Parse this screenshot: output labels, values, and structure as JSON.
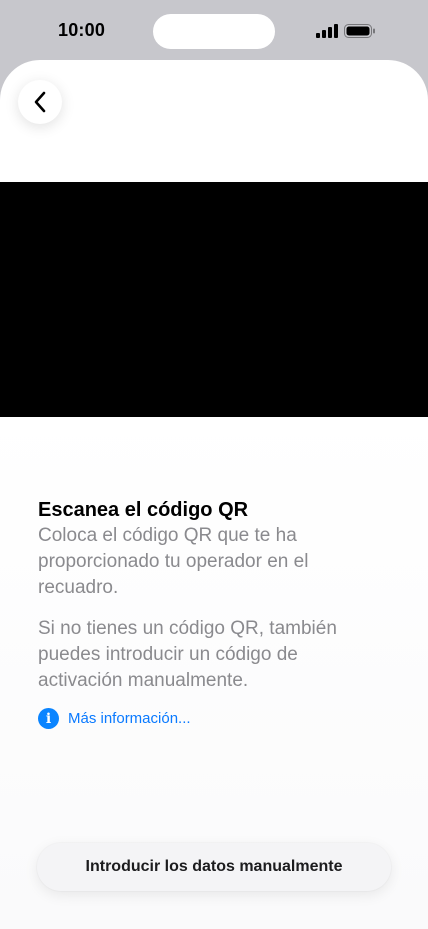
{
  "status_bar": {
    "time": "10:00"
  },
  "icons": {
    "back": "chevron-left-icon",
    "info": "info-icon",
    "signal": "signal-icon",
    "battery": "battery-icon"
  },
  "main": {
    "title": "Escanea el código QR",
    "description": "Coloca el código QR que te ha proporcionado tu operador en el recuadro.",
    "secondary": "Si no tienes un código QR, también puedes introducir un código de activación manualmente.",
    "info_icon_glyph": "i",
    "more_info_link": "Más información..."
  },
  "footer": {
    "manual_button_label": "Introducir los datos manualmente"
  },
  "colors": {
    "accent": "#0a84ff",
    "viewfinder": "#000000",
    "frame": "#c7c7cc"
  }
}
